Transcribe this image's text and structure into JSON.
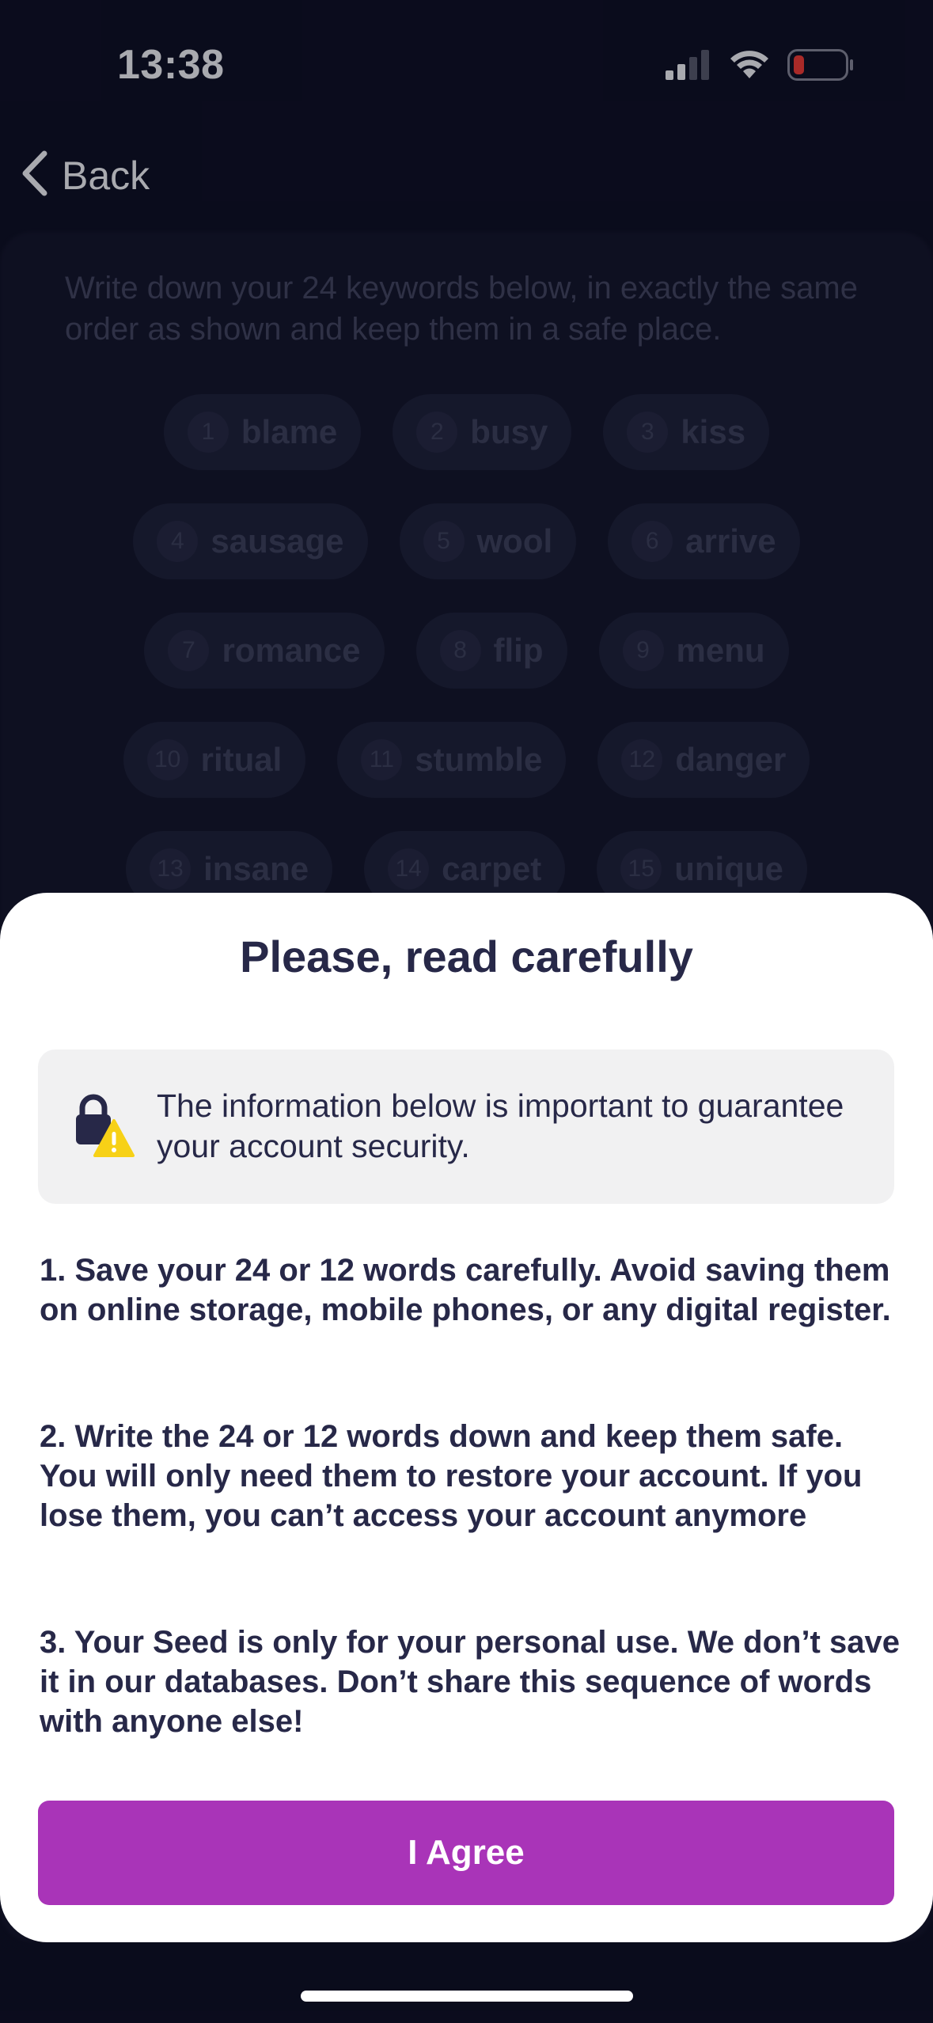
{
  "status_bar": {
    "time": "13:38",
    "icons": [
      "cellular-signal-icon",
      "wifi-icon",
      "battery-low-icon"
    ]
  },
  "nav": {
    "back_label": "Back",
    "back_icon": "chevron-left-icon"
  },
  "seed_backdrop": {
    "intro": "Write down your 24 keywords below, in exactly the same order as shown and keep them in a safe place.",
    "words": [
      {
        "num": "1",
        "word": "blame"
      },
      {
        "num": "2",
        "word": "busy"
      },
      {
        "num": "3",
        "word": "kiss"
      },
      {
        "num": "4",
        "word": "sausage"
      },
      {
        "num": "5",
        "word": "wool"
      },
      {
        "num": "6",
        "word": "arrive"
      },
      {
        "num": "7",
        "word": "romance"
      },
      {
        "num": "8",
        "word": "flip"
      },
      {
        "num": "9",
        "word": "menu"
      },
      {
        "num": "10",
        "word": "ritual"
      },
      {
        "num": "11",
        "word": "stumble"
      },
      {
        "num": "12",
        "word": "danger"
      },
      {
        "num": "13",
        "word": "insane"
      },
      {
        "num": "14",
        "word": "carpet"
      },
      {
        "num": "15",
        "word": "unique"
      }
    ]
  },
  "sheet": {
    "title": "Please, read carefully",
    "notice": {
      "icon": "lock-warning-icon",
      "text": "The information below is important to guarantee your account security."
    },
    "rules": [
      "1. Save your 24 or 12 words carefully. Avoid saving them on online storage, mobile phones, or any digital register.",
      "2. Write the 24 or 12 words down and keep them safe. You will only need them to restore your account. If you lose them, you can’t access your account anymore",
      "3. Your Seed is only for your personal use. We don’t save it in our databases. Don’t share this sequence of words with anyone else!"
    ],
    "agree_label": "I Agree"
  },
  "colors": {
    "background": "#0c0d1e",
    "sheet": "#ffffff",
    "text_dark": "#272848",
    "accent": "#a934b8",
    "notice_bg": "#f1f1f2",
    "warning": "#f7d117"
  }
}
